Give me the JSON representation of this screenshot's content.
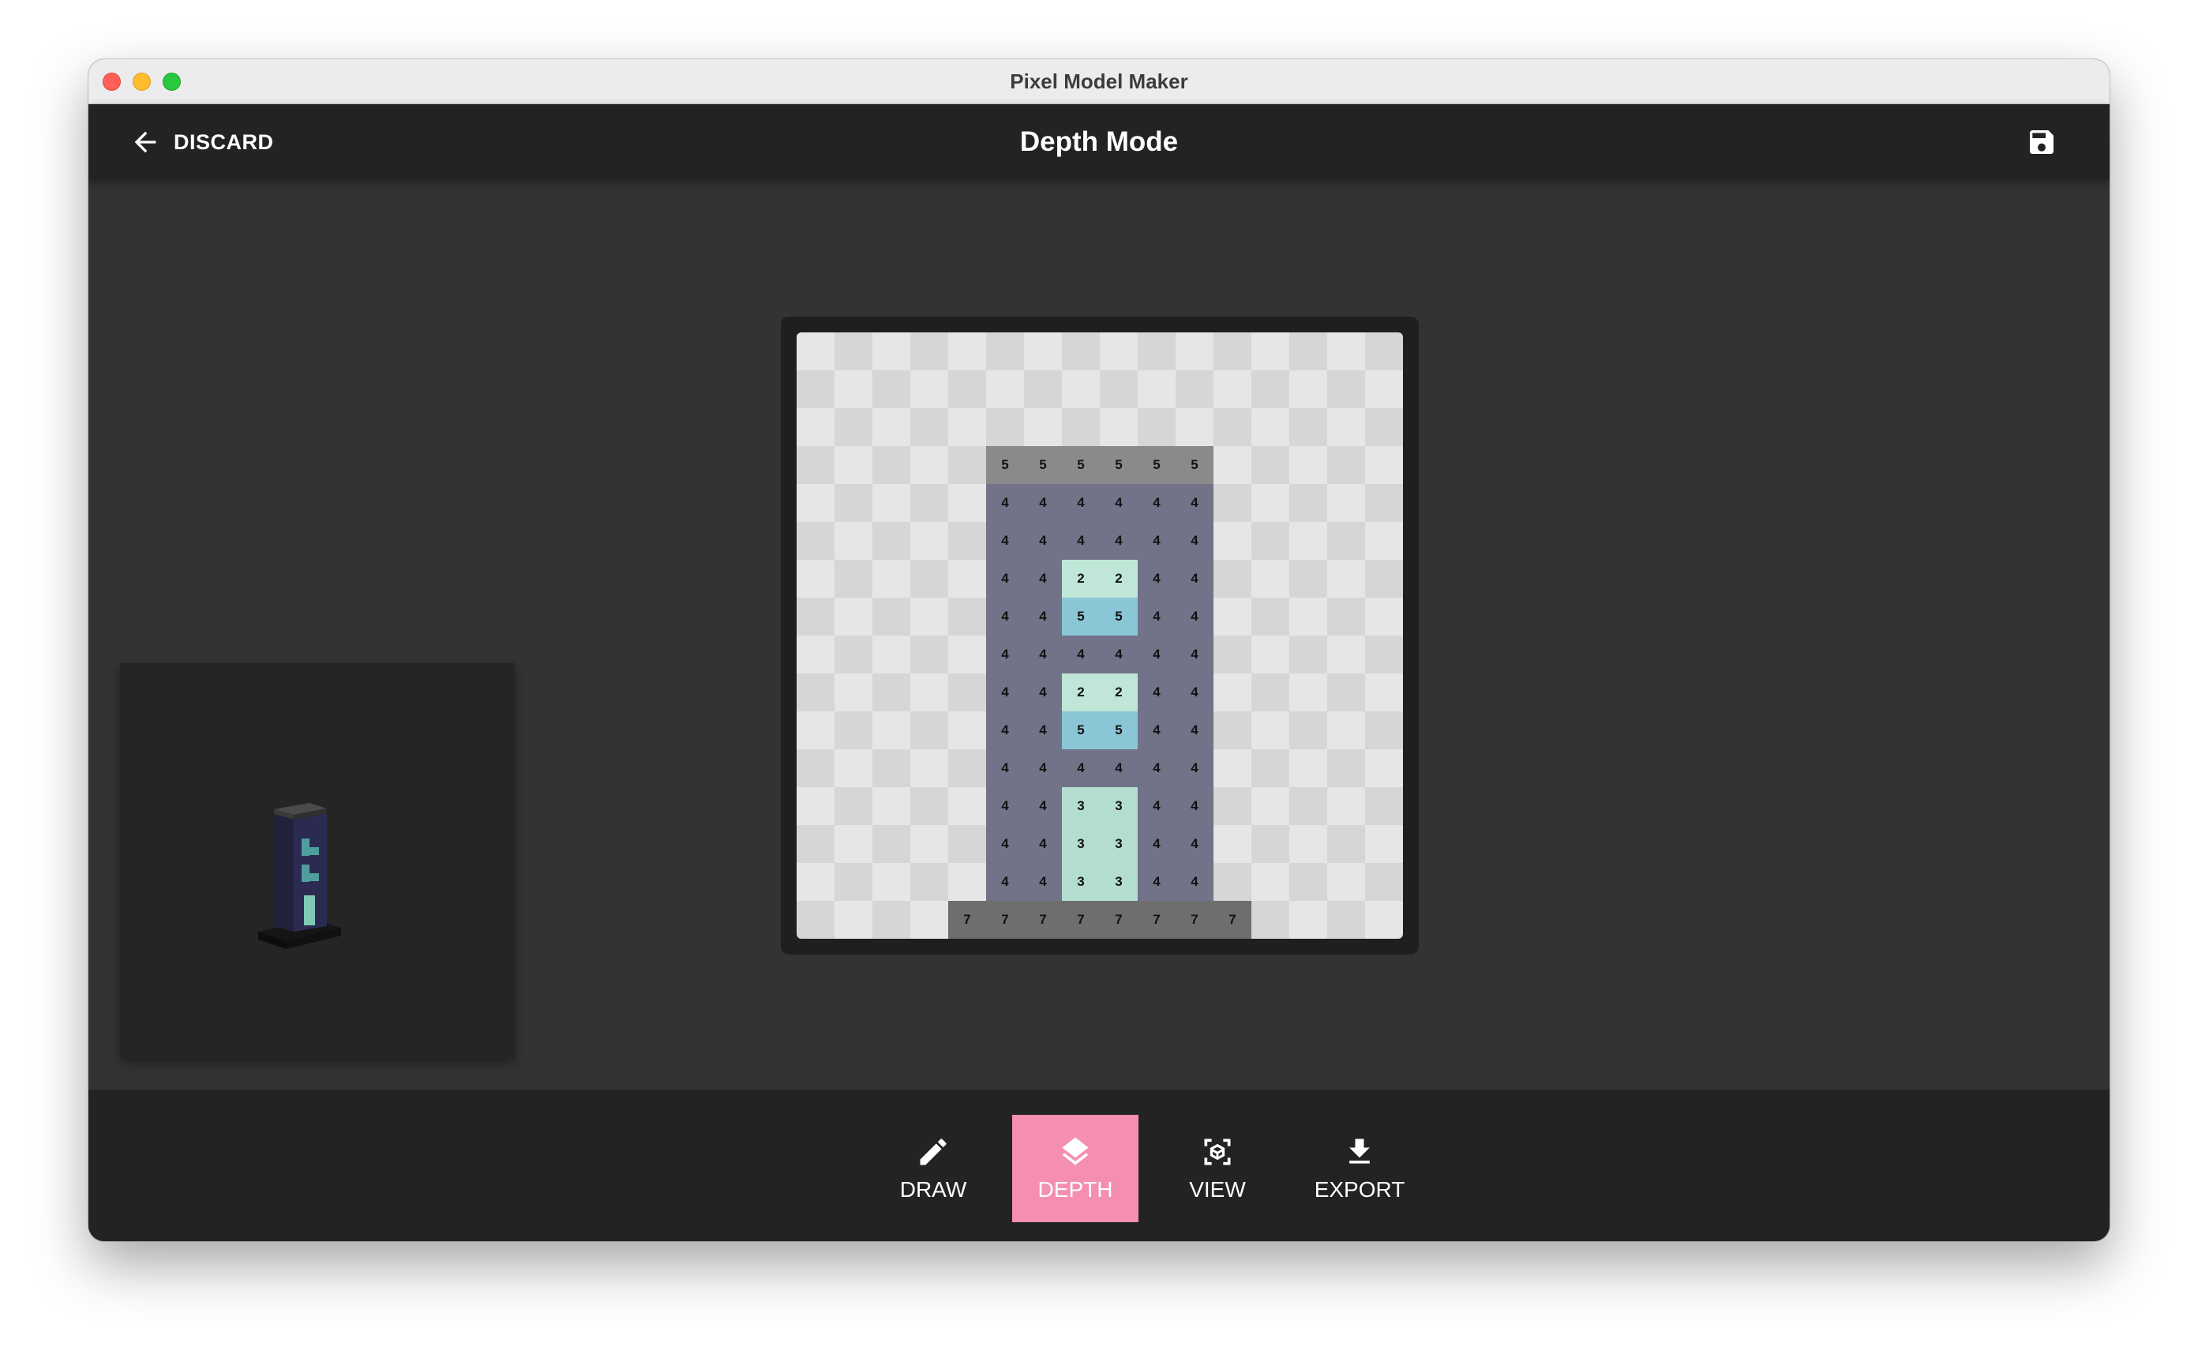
{
  "window": {
    "title": "Pixel Model Maker"
  },
  "appbar": {
    "discard_label": "DISCARD",
    "title": "Depth Mode",
    "save_icon": "save-icon",
    "back_icon": "arrow-left-icon"
  },
  "editor": {
    "grid_size": 16,
    "rows": [
      "................",
      "................",
      "................",
      ".....555555.....",
      ".....444444.....",
      ".....444444.....",
      ".....442244.....",
      ".....445544.....",
      ".....444444.....",
      ".....442244.....",
      ".....445544.....",
      ".....444444.....",
      ".....443344.....",
      ".....443344.....",
      ".....443344.....",
      "....77777777...."
    ],
    "colors": {
      "checker_light": "#e6e6e6",
      "checker_dark": "#d6d6d6",
      "roof": "#8a8a8a",
      "wall": "#727289",
      "window_light": "#bfe6d6",
      "window_blue": "#8ac6d6",
      "base": "#6e6e6e",
      "door": "#b3ddd0"
    }
  },
  "toolbar": {
    "items": [
      {
        "label": "DRAW",
        "icon": "pencil-icon",
        "active": false
      },
      {
        "label": "DEPTH",
        "icon": "layers-icon",
        "active": true
      },
      {
        "label": "VIEW",
        "icon": "cube-view-icon",
        "active": false
      },
      {
        "label": "EXPORT",
        "icon": "download-icon",
        "active": false
      }
    ]
  }
}
